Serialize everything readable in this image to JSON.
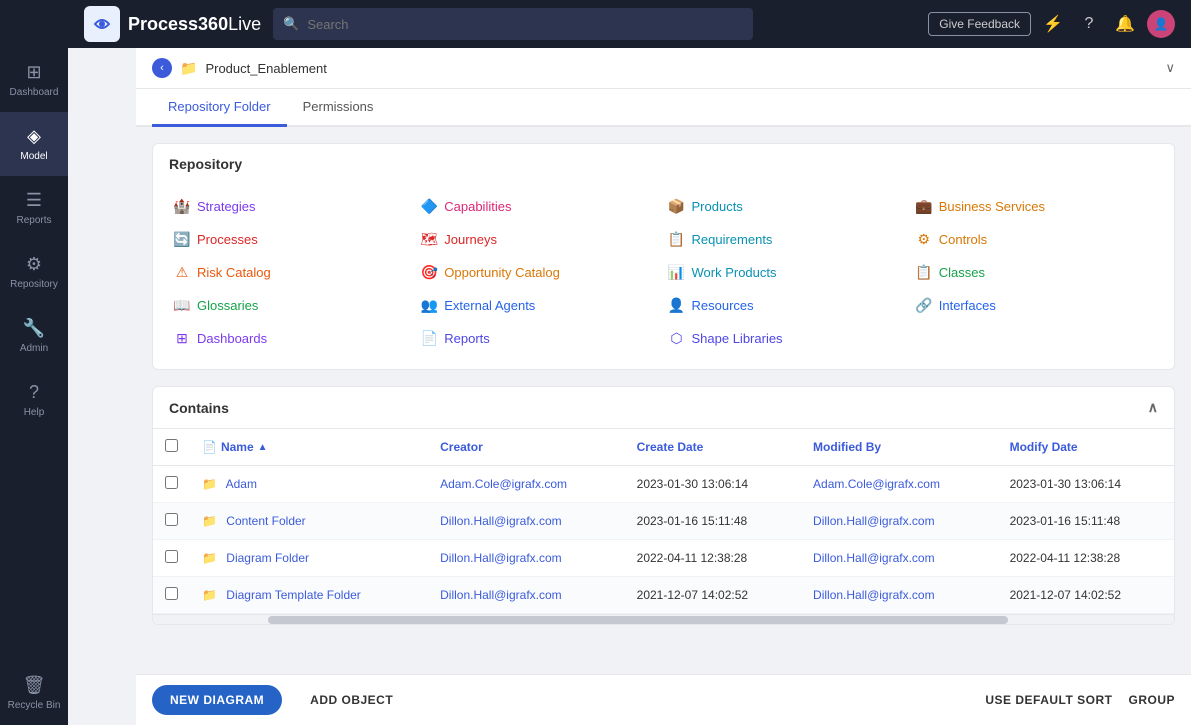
{
  "app": {
    "name": "Process360",
    "name_suffix": "Live"
  },
  "topbar": {
    "search_placeholder": "Search",
    "give_feedback": "Give Feedback"
  },
  "sidebar": {
    "items": [
      {
        "id": "dashboard",
        "label": "Dashboard",
        "icon": "⊞"
      },
      {
        "id": "model",
        "label": "Model",
        "icon": "◈",
        "active": true
      },
      {
        "id": "reports",
        "label": "Reports",
        "icon": "☰"
      },
      {
        "id": "repository",
        "label": "Repository",
        "icon": "⚙"
      },
      {
        "id": "admin",
        "label": "Admin",
        "icon": "🔧"
      },
      {
        "id": "help",
        "label": "Help",
        "icon": "?"
      },
      {
        "id": "recycle",
        "label": "Recycle Bin",
        "icon": "🗑"
      }
    ]
  },
  "breadcrumb": {
    "text": "Product_Enablement"
  },
  "tabs": [
    {
      "id": "repo-folder",
      "label": "Repository Folder",
      "active": true
    },
    {
      "id": "permissions",
      "label": "Permissions",
      "active": false
    }
  ],
  "repository": {
    "title": "Repository",
    "items": [
      {
        "label": "Strategies",
        "icon": "🏰",
        "color": "c-purple"
      },
      {
        "label": "Capabilities",
        "icon": "🔷",
        "color": "c-pink"
      },
      {
        "label": "Products",
        "icon": "📦",
        "color": "c-teal"
      },
      {
        "label": "Business Services",
        "icon": "💼",
        "color": "c-amber"
      },
      {
        "label": "Processes",
        "icon": "🔄",
        "color": "c-red"
      },
      {
        "label": "Journeys",
        "icon": "🗺",
        "color": "c-red"
      },
      {
        "label": "Requirements",
        "icon": "📋",
        "color": "c-teal"
      },
      {
        "label": "Controls",
        "icon": "⚙",
        "color": "c-amber"
      },
      {
        "label": "Risk Catalog",
        "icon": "⚠",
        "color": "c-orange"
      },
      {
        "label": "Opportunity Catalog",
        "icon": "🎯",
        "color": "c-amber"
      },
      {
        "label": "Work Products",
        "icon": "📊",
        "color": "c-teal"
      },
      {
        "label": "Classes",
        "icon": "📋",
        "color": "c-green"
      },
      {
        "label": "Glossaries",
        "icon": "📖",
        "color": "c-green"
      },
      {
        "label": "External Agents",
        "icon": "👥",
        "color": "c-blue"
      },
      {
        "label": "Resources",
        "icon": "👤",
        "color": "c-blue"
      },
      {
        "label": "Interfaces",
        "icon": "🔗",
        "color": "c-blue"
      },
      {
        "label": "Dashboards",
        "icon": "⊞",
        "color": "c-purple"
      },
      {
        "label": "Reports",
        "icon": "📄",
        "color": "c-indigo"
      },
      {
        "label": "Shape Libraries",
        "icon": "⬡",
        "color": "c-indigo"
      }
    ]
  },
  "contains": {
    "title": "Contains",
    "columns": [
      {
        "label": "Name",
        "sortable": true
      },
      {
        "label": "Creator"
      },
      {
        "label": "Create Date"
      },
      {
        "label": "Modified By"
      },
      {
        "label": "Modify Date"
      }
    ],
    "rows": [
      {
        "name": "Adam",
        "creator": "Adam.Cole@igrafx.com",
        "create_date": "2023-01-30 13:06:14",
        "modified_by": "Adam.Cole@igrafx.com",
        "modify_date": "2023-01-30 13:06:14"
      },
      {
        "name": "Content Folder",
        "creator": "Dillon.Hall@igrafx.com",
        "create_date": "2023-01-16 15:11:48",
        "modified_by": "Dillon.Hall@igrafx.com",
        "modify_date": "2023-01-16 15:11:48"
      },
      {
        "name": "Diagram Folder",
        "creator": "Dillon.Hall@igrafx.com",
        "create_date": "2022-04-11 12:38:28",
        "modified_by": "Dillon.Hall@igrafx.com",
        "modify_date": "2022-04-11 12:38:28"
      },
      {
        "name": "Diagram Template Folder",
        "creator": "Dillon.Hall@igrafx.com",
        "create_date": "2021-12-07 14:02:52",
        "modified_by": "Dillon.Hall@igrafx.com",
        "modify_date": "2021-12-07 14:02:52"
      }
    ]
  },
  "bottom_toolbar": {
    "new_diagram": "NEW DIAGRAM",
    "add_object": "ADD OBJECT",
    "use_default_sort": "USE DEFAULT SORT",
    "group": "GROUP"
  }
}
